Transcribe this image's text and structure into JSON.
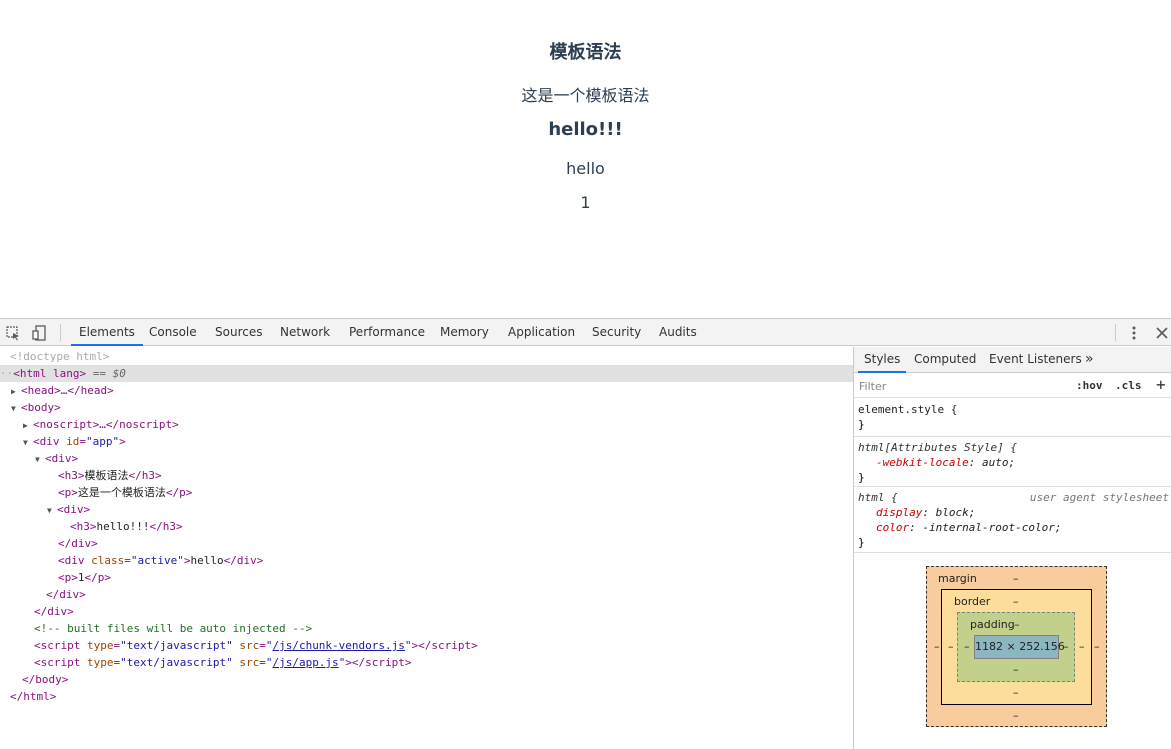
{
  "page": {
    "h3_1": "模板语法",
    "p_1": "这是一个模板语法",
    "h3_2": "hello!!!",
    "active_div": "hello",
    "p_2": "1"
  },
  "devtools": {
    "tabs": [
      "Elements",
      "Console",
      "Sources",
      "Network",
      "Performance",
      "Memory",
      "Application",
      "Security",
      "Audits"
    ],
    "active_tab": "Elements",
    "tree": {
      "doctype": "<!doctype html>",
      "html_open": "<html lang",
      "html_sel": "== $0",
      "head": "<head>…</head>",
      "body_open": "<body>",
      "noscript": "<noscript>…</noscript>",
      "div_app_tag": "<div ",
      "div_app_attr": "id",
      "div_app_val": "\"app\"",
      "div_open": "<div>",
      "h3_open": "<h3>",
      "h3_text": "模板语法",
      "h3_close": "</h3>",
      "p_open": "<p>",
      "p_text": "这是一个模板语法",
      "p_close": "</p>",
      "div2_open": "<div>",
      "h3b_open": "<h3>",
      "h3b_text": "hello!!!",
      "h3b_close": "</h3>",
      "div2_close": "</div>",
      "divc_tag": "<div ",
      "divc_attr": "class",
      "divc_val": "\"active\"",
      "divc_text": "hello",
      "divc_close": "</div>",
      "p2_open": "<p>",
      "p2_text": "1",
      "p2_close": "</p>",
      "div_close": "</div>",
      "div_app_close": "</div>",
      "comment": "<!-- built files will be auto injected -->",
      "script1_src": "/js/chunk-vendors.js",
      "script2_src": "/js/app.js",
      "script_type_attr": "type",
      "script_type_val": "\"text/javascript\"",
      "script_src_attr": "src",
      "body_close": "</body>",
      "html_close": "</html>"
    },
    "styles": {
      "tabs": [
        "Styles",
        "Computed",
        "Event Listeners"
      ],
      "active_tab": "Styles",
      "more_icon": "»",
      "filter_placeholder": "Filter",
      "hov": ":hov",
      "cls": ".cls",
      "plus": "+",
      "rules": [
        {
          "selector": "element.style {",
          "close": "}"
        },
        {
          "selector": "html[Attributes Style] {",
          "props": [
            {
              "name": "-webkit-locale",
              "value": "auto;"
            }
          ],
          "close": "}"
        },
        {
          "selector": "html {",
          "source": "user agent stylesheet",
          "props": [
            {
              "name": "display",
              "value": "block;"
            },
            {
              "name": "color",
              "value": "-internal-root-color;"
            }
          ],
          "close": "}"
        }
      ],
      "box_model": {
        "margin_label": "margin",
        "border_label": "border",
        "padding_label": "padding",
        "content": "1182 × 252.156",
        "dash": "–"
      }
    }
  }
}
